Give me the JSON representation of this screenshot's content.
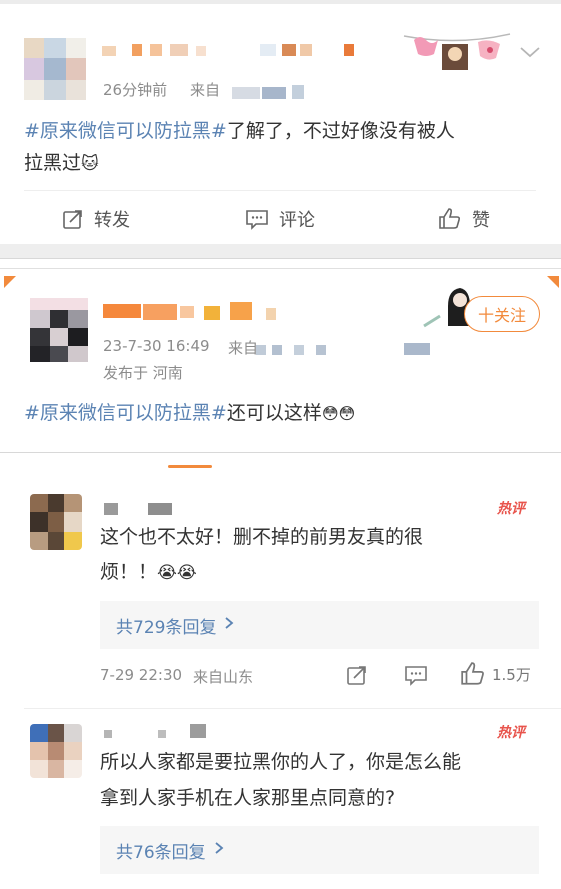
{
  "post1": {
    "time": "26分钟前",
    "source_prefix": "来自",
    "topic": "#原来微信可以防拉黑#",
    "text_line1": "了解了，不过好像没有被人",
    "text_line2": "拉黑过",
    "emoji": "🐱",
    "actions": {
      "repost": "转发",
      "comment": "评论",
      "like": "赞"
    }
  },
  "post2": {
    "timestamp": "23-7-30 16:49",
    "source_prefix": "来自",
    "location": "发布于 河南",
    "follow_label": "十关注",
    "topic": "#原来微信可以防拉黑#",
    "text": "还可以这样",
    "emoji": "😳😳"
  },
  "comments": [
    {
      "badge": "热评",
      "line1": "这个也不太好！删不掉的前男友真的很",
      "line2": "烦！！",
      "emoji": "😭😭",
      "reply_label": "共729条回复",
      "date": "7-29 22:30",
      "location": "来自山东",
      "likes": "1.5万"
    },
    {
      "badge": "热评",
      "line1": "所以人家都是要拉黑你的人了，你是怎么能",
      "line2": "拿到人家手机在人家那里点同意的?",
      "reply_label": "共76条回复"
    }
  ],
  "colors": {
    "accent": "#f28a3c",
    "topic_blue": "#5b83b3",
    "hot_red": "#e8544c"
  }
}
